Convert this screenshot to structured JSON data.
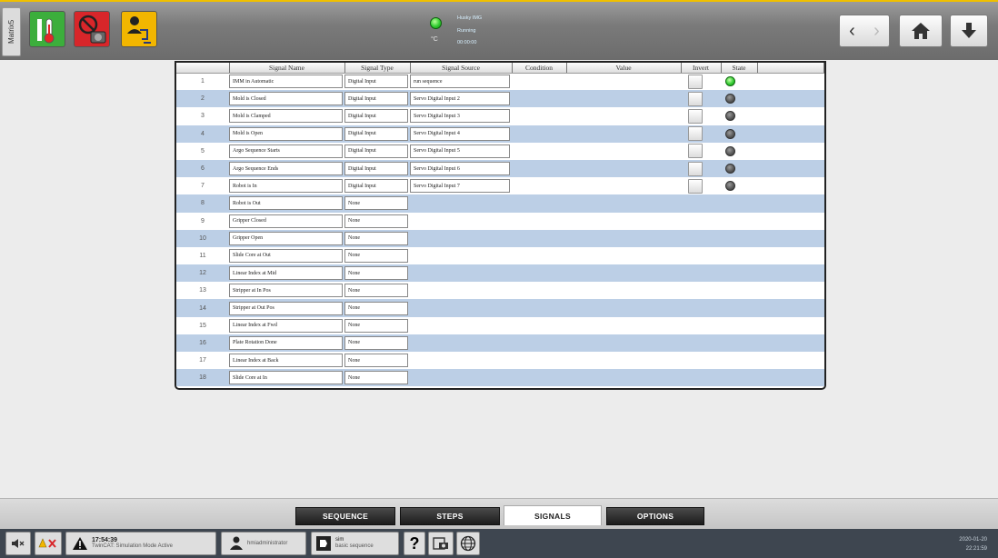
{
  "header": {
    "side_tab": "Matrix5",
    "status": {
      "unit": "°C",
      "lines": [
        "Husky IMG",
        "Running",
        "00:00:00"
      ]
    }
  },
  "table": {
    "columns": [
      "",
      "Signal Name",
      "Signal Type",
      "Signal Source",
      "Condition",
      "Value",
      "Invert",
      "State"
    ],
    "rows": [
      {
        "num": "1",
        "name": "IMM in Automatic",
        "type": "Digital Input",
        "source": "run sequence",
        "state": "on"
      },
      {
        "num": "2",
        "name": "Mold is Closed",
        "type": "Digital Input",
        "source": "Servo Digital Input 2",
        "state": "off"
      },
      {
        "num": "3",
        "name": "Mold is Clamped",
        "type": "Digital Input",
        "source": "Servo Digital Input 3",
        "state": "off"
      },
      {
        "num": "4",
        "name": "Mold is Open",
        "type": "Digital Input",
        "source": "Servo Digital Input 4",
        "state": "off"
      },
      {
        "num": "5",
        "name": "Argo Sequence Starts",
        "type": "Digital Input",
        "source": "Servo Digital Input 5",
        "state": "off"
      },
      {
        "num": "6",
        "name": "Argo Sequence Ends",
        "type": "Digital Input",
        "source": "Servo Digital Input 6",
        "state": "off"
      },
      {
        "num": "7",
        "name": "Robot is In",
        "type": "Digital Input",
        "source": "Servo Digital Input 7",
        "state": "off"
      },
      {
        "num": "8",
        "name": "Robot is Out",
        "type": "None"
      },
      {
        "num": "9",
        "name": "Gripper Closed",
        "type": "None"
      },
      {
        "num": "10",
        "name": "Gripper Open",
        "type": "None"
      },
      {
        "num": "11",
        "name": "Slide Core at Out",
        "type": "None"
      },
      {
        "num": "12",
        "name": "Linear Index at Mid",
        "type": "None"
      },
      {
        "num": "13",
        "name": "Stripper at In Pos",
        "type": "None"
      },
      {
        "num": "14",
        "name": "Stripper at Out Pos",
        "type": "None"
      },
      {
        "num": "15",
        "name": "Linear Index at Fwd",
        "type": "None"
      },
      {
        "num": "16",
        "name": "Plate Rotation Done",
        "type": "None"
      },
      {
        "num": "17",
        "name": "Linear Index at Back",
        "type": "None"
      },
      {
        "num": "18",
        "name": "Slide Core at In",
        "type": "None"
      }
    ]
  },
  "tabs": [
    "SEQUENCE",
    "STEPS",
    "SIGNALS",
    "OPTIONS"
  ],
  "active_tab": "SIGNALS",
  "statusbar": {
    "alarm_time": "17:54:39",
    "alarm_text": "TwinCAT: Simulation Mode Active",
    "user": "hmiadministrator",
    "mode_title": "sim",
    "mode_sub": "basic sequence",
    "date": "2020-01-20",
    "time": "22:21:59"
  },
  "icons": {
    "top": [
      "temperature-icon",
      "motor-disabled-icon",
      "operator-icon"
    ],
    "nav": [
      "back-icon",
      "forward-icon",
      "home-icon",
      "download-icon"
    ],
    "bottom": [
      "mute-icon",
      "alarm-reset-icon",
      "warning-icon",
      "user-icon",
      "mode-icon",
      "help-icon",
      "screenshot-icon",
      "language-icon"
    ]
  },
  "colors": {
    "accent": "#f0c000",
    "row_alt": "#bccfe6",
    "led_on": "#33cc33",
    "led_off": "#555555"
  }
}
